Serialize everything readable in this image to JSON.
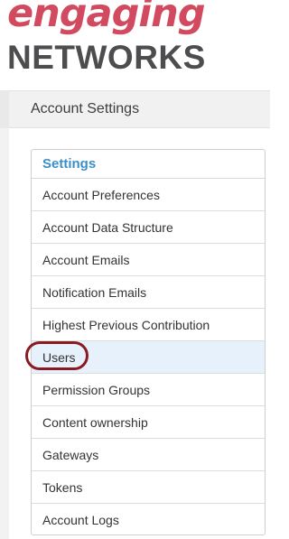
{
  "logo": {
    "top_text": "engaging",
    "bottom_text": "NETWORKS"
  },
  "header": {
    "title": "Account Settings"
  },
  "panel": {
    "heading": "Settings",
    "items": [
      {
        "label": "Account Preferences"
      },
      {
        "label": "Account Data Structure"
      },
      {
        "label": "Account Emails"
      },
      {
        "label": "Notification Emails"
      },
      {
        "label": "Highest Previous Contribution"
      },
      {
        "label": "Users"
      },
      {
        "label": "Permission Groups"
      },
      {
        "label": "Content ownership"
      },
      {
        "label": "Gateways"
      },
      {
        "label": "Tokens"
      },
      {
        "label": "Account Logs"
      }
    ],
    "active_item": "Users"
  },
  "colors": {
    "brand_red": "#d24a5f",
    "brand_gray": "#4d4d4f",
    "heading_blue": "#3a8fc7",
    "active_bg": "#e6f1fb",
    "annotation_ring": "#8a1a22"
  }
}
